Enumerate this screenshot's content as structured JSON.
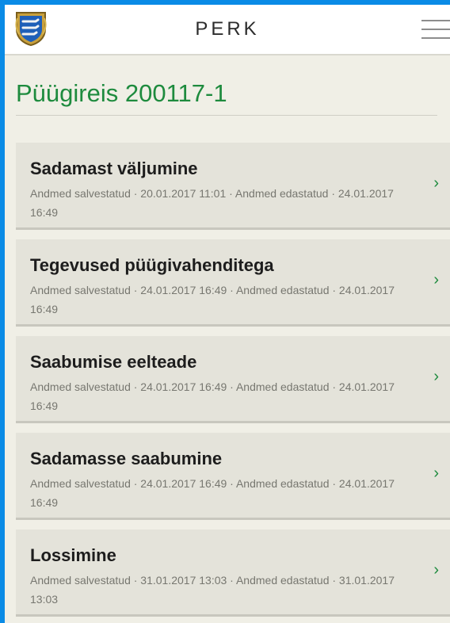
{
  "header": {
    "app_title": "PERK",
    "logo_icon": "estonian-coat-of-arms",
    "menu_icon": "hamburger-menu-icon"
  },
  "page": {
    "title": "Püügireis 200117-1"
  },
  "items": [
    {
      "title": "Sadamast väljumine",
      "meta": "Andmed salvestatud · 20.01.2017 11:01 · Andmed edastatud · 24.01.2017 16:49"
    },
    {
      "title": "Tegevused püügivahenditega",
      "meta": "Andmed salvestatud · 24.01.2017 16:49 · Andmed edastatud · 24.01.2017 16:49"
    },
    {
      "title": "Saabumise eelteade",
      "meta": "Andmed salvestatud · 24.01.2017 16:49 · Andmed edastatud · 24.01.2017 16:49"
    },
    {
      "title": "Sadamasse saabumine",
      "meta": "Andmed salvestatud · 24.01.2017 16:49 · Andmed edastatud · 24.01.2017 16:49"
    },
    {
      "title": "Lossimine",
      "meta": "Andmed salvestatud · 31.01.2017 13:03 · Andmed edastatud · 31.01.2017 13:03"
    }
  ],
  "chevron": "›",
  "colors": {
    "accent": "#1e8b3e",
    "background": "#f0efe6",
    "card": "#e4e3da",
    "frame": "#0a8be6"
  }
}
